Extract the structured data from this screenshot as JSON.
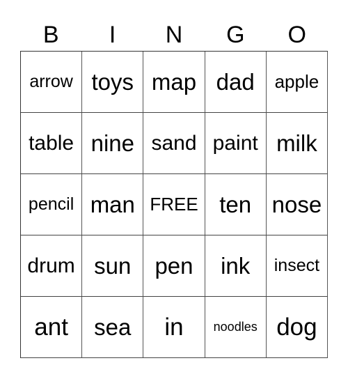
{
  "header": {
    "letters": [
      "B",
      "I",
      "N",
      "G",
      "O"
    ]
  },
  "card": {
    "rows": [
      [
        "arrow",
        "toys",
        "map",
        "dad",
        "apple"
      ],
      [
        "table",
        "nine",
        "sand",
        "paint",
        "milk"
      ],
      [
        "pencil",
        "man",
        "FREE",
        "ten",
        "nose"
      ],
      [
        "drum",
        "sun",
        "pen",
        "ink",
        "insect"
      ],
      [
        "ant",
        "sea",
        "in",
        "noodles",
        "dog"
      ]
    ]
  }
}
